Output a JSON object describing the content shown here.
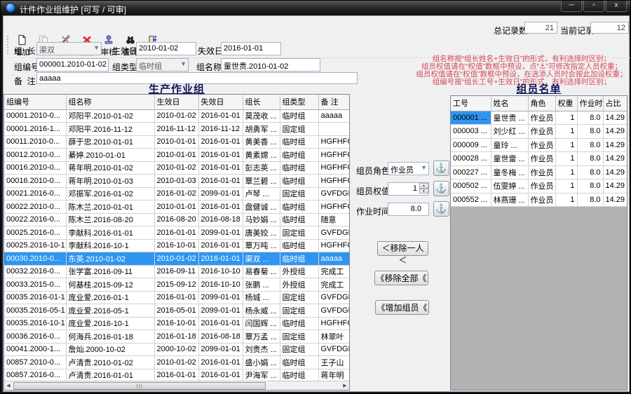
{
  "window": {
    "title": "计件作业组维护  [可写 / 可审]",
    "controls": {
      "minimize": "─",
      "restore": "▫",
      "close": "x"
    }
  },
  "toolbar": {
    "buttons": [
      {
        "label": "增加"
      },
      {
        "label": "复制"
      },
      {
        "label": "修改"
      },
      {
        "label": "删除"
      },
      {
        "label": "审核"
      },
      {
        "label": "查询"
      },
      {
        "label": "退出"
      }
    ]
  },
  "counter": {
    "total_label": "总记录数",
    "total_value": "21",
    "current_label": "当前记录",
    "current_value": "12"
  },
  "form": {
    "leader_label": "组  长",
    "leader_value": "渠双",
    "effective_label": "生效日",
    "effective_value": "2010-01-02",
    "expire_label": "失效日",
    "expire_value": "2016-01-01",
    "group_no_label": "组编号",
    "group_no_value": "000001.2010-01-02",
    "group_type_label": "组类型",
    "group_type_value": "临时组",
    "group_name_label": "组名称",
    "group_name_value": "童世贵.2010-01-02",
    "remark_label": "备  注",
    "remark_value": "aaaaa"
  },
  "notes": {
    "color": "#d44a5e",
    "lines": [
      "组名称按“组长姓名+生效日”的形式，有利选择时区别；",
      "组员权值请在“权值”数框中预设，点“⚓”可修改指定人员权重；",
      "组员权值请在“权值”数框中预设，在选添人员时会按此加设权重；",
      "组编号按“组长工号+生效日”的形式，有利选择时区别；"
    ]
  },
  "left_panel": {
    "title": "生产作业组",
    "columns": [
      "组编号",
      "组名称",
      "生效日",
      "失效日",
      "组长",
      "组类型",
      "备  注"
    ],
    "selected_row": 11,
    "rows": [
      [
        "00001.2010-0...",
        "邓阳平.2010-01-02",
        "2010-01-02",
        "2016-01-01",
        "莫茂收 ...",
        "临时组",
        "aaaaa"
      ],
      [
        "00001.2016-1...",
        "邓阳平.2016-11-12",
        "2016-11-12",
        "2016-11-12",
        "胡勇军 ...",
        "固定组",
        ""
      ],
      [
        "00011.2010-0...",
        "薛于忠.2010-01-01",
        "2010-01-01",
        "2016-01-01",
        "黄美香 ...",
        "临时组",
        "HGFHFG"
      ],
      [
        "00012.2010-0...",
        "綦婷.2010-01-01",
        "2010-01-01",
        "2016-01-01",
        "黄素嫦 ...",
        "临时组",
        "HGFHFG"
      ],
      [
        "00016.2010-0...",
        "蒋年明.2010-01-02",
        "2010-01-02",
        "2016-01-01",
        "彭志英 ...",
        "临时组",
        "HGFHFG"
      ],
      [
        "00016.2010-0...",
        "蒋年明.2010-01-03",
        "2010-01-03",
        "2016-01-01",
        "覃兰碧 ...",
        "临时组",
        "HGFHFG"
      ],
      [
        "00021.2016-0...",
        "邓振军.2016-01-02",
        "2016-01-02",
        "2099-01-01",
        "卢琴    ...",
        "固定组",
        "GVFDGF"
      ],
      [
        "00022.2010-0...",
        "陈木兰.2010-01-01",
        "2010-01-01",
        "2016-01-01",
        "盘健诚 ...",
        "临时组",
        "HGFHFG"
      ],
      [
        "00022.2016-0...",
        "陈木兰.2016-08-20",
        "2016-08-20",
        "2016-08-18",
        "马妙娟 ...",
        "临时组",
        "随意"
      ],
      [
        "00025.2016-0...",
        "李献科.2016-01-01",
        "2016-01-01",
        "2099-01-01",
        "唐美姣 ...",
        "固定组",
        "GVFDGF"
      ],
      [
        "00025.2016-10-1",
        "李献科.2016-10-1",
        "2016-10-01",
        "2016-01-01",
        "覃万吨 ...",
        "临时组",
        "HGFHFG"
      ],
      [
        "00030.2010-0...",
        "东英.2010-01-02",
        "2010-01-02",
        "2016-01-01",
        "渠双    ...",
        "临时组",
        "aaaaa"
      ],
      [
        "00032.2016-0...",
        "张学富.2016-09-11",
        "2016-09-11",
        "2016-10-10",
        "易春菊 ...",
        "外授组",
        "完成工"
      ],
      [
        "00033.2015-0...",
        "何基桂.2015-09-12",
        "2015-09-12",
        "2016-10-10",
        "张鹏    ...",
        "外授组",
        "完成工"
      ],
      [
        "00035.2016-01-1",
        "庞业爱.2016-01-1",
        "2016-01-01",
        "2099-01-01",
        "杨城    ...",
        "固定组",
        "GVFDGF"
      ],
      [
        "00035.2016-05-1",
        "庞业爱.2016-05-1",
        "2016-05-01",
        "2099-01-01",
        "杨永威 ...",
        "固定组",
        "GVFDGF"
      ],
      [
        "00035.2016-10-1",
        "庞业爱.2016-10-1",
        "2016-10-01",
        "2016-01-01",
        "闫国辉 ...",
        "临时组",
        "HGFHFG"
      ],
      [
        "00036.2016-0...",
        "何海兵.2016-01-18",
        "2016-01-18",
        "2016-08-18",
        "覃万孟 ...",
        "固定组",
        "林翠叶"
      ],
      [
        "00041.2000-1...",
        "詹灿.2000-10-02",
        "2000-10-02",
        "2099-01-01",
        "刘贵杰 ...",
        "固定组",
        "GVFDGF"
      ],
      [
        "00857.2010-0...",
        "卢清贵.2010-01-02",
        "2010-01-02",
        "2016-01-01",
        "盛小娟 ...",
        "临时组",
        "王子山"
      ],
      [
        "00857.2016-0...",
        "卢清贵.2016-01-01",
        "2016-01-01",
        "2016-01-01",
        "尹海军 ...",
        "临时组",
        "蒋年明"
      ]
    ]
  },
  "middle_panel": {
    "role_label": "组员角色",
    "role_value": "作业员",
    "weight_label": "组员权值",
    "weight_value": "1",
    "time_label": "作业时间",
    "time_value": "8.0",
    "anchor_icon": "⚓",
    "remove_one_label": "＜移除一人＜",
    "remove_all_label": "《移除全部《",
    "add_member_label": "《增加组员《"
  },
  "right_panel": {
    "title": "组员名单",
    "columns": [
      "工号",
      "姓名",
      "角色",
      "权重",
      "作业时",
      "占比"
    ],
    "selected_cell": "0,0",
    "rows": [
      [
        "000001 ...",
        "童世贵 ...",
        "作业员",
        "1",
        "8.0",
        "14.29"
      ],
      [
        "000003 ...",
        "刘少红 ...",
        "作业员",
        "1",
        "8.0",
        "14.29"
      ],
      [
        "000009 ...",
        "童玲    ...",
        "作业员",
        "1",
        "8.0",
        "14.29"
      ],
      [
        "000028 ...",
        "童世雷 ...",
        "作业员",
        "1",
        "8.0",
        "14.29"
      ],
      [
        "000227 ...",
        "童冬梅 ...",
        "作业员",
        "1",
        "8.0",
        "14.29"
      ],
      [
        "000502 ...",
        "伍雯婷 ...",
        "作业员",
        "1",
        "8.0",
        "14.29"
      ],
      [
        "000552 ...",
        "林燕珊 ...",
        "作业员",
        "1",
        "8.0",
        "14.29"
      ]
    ]
  }
}
